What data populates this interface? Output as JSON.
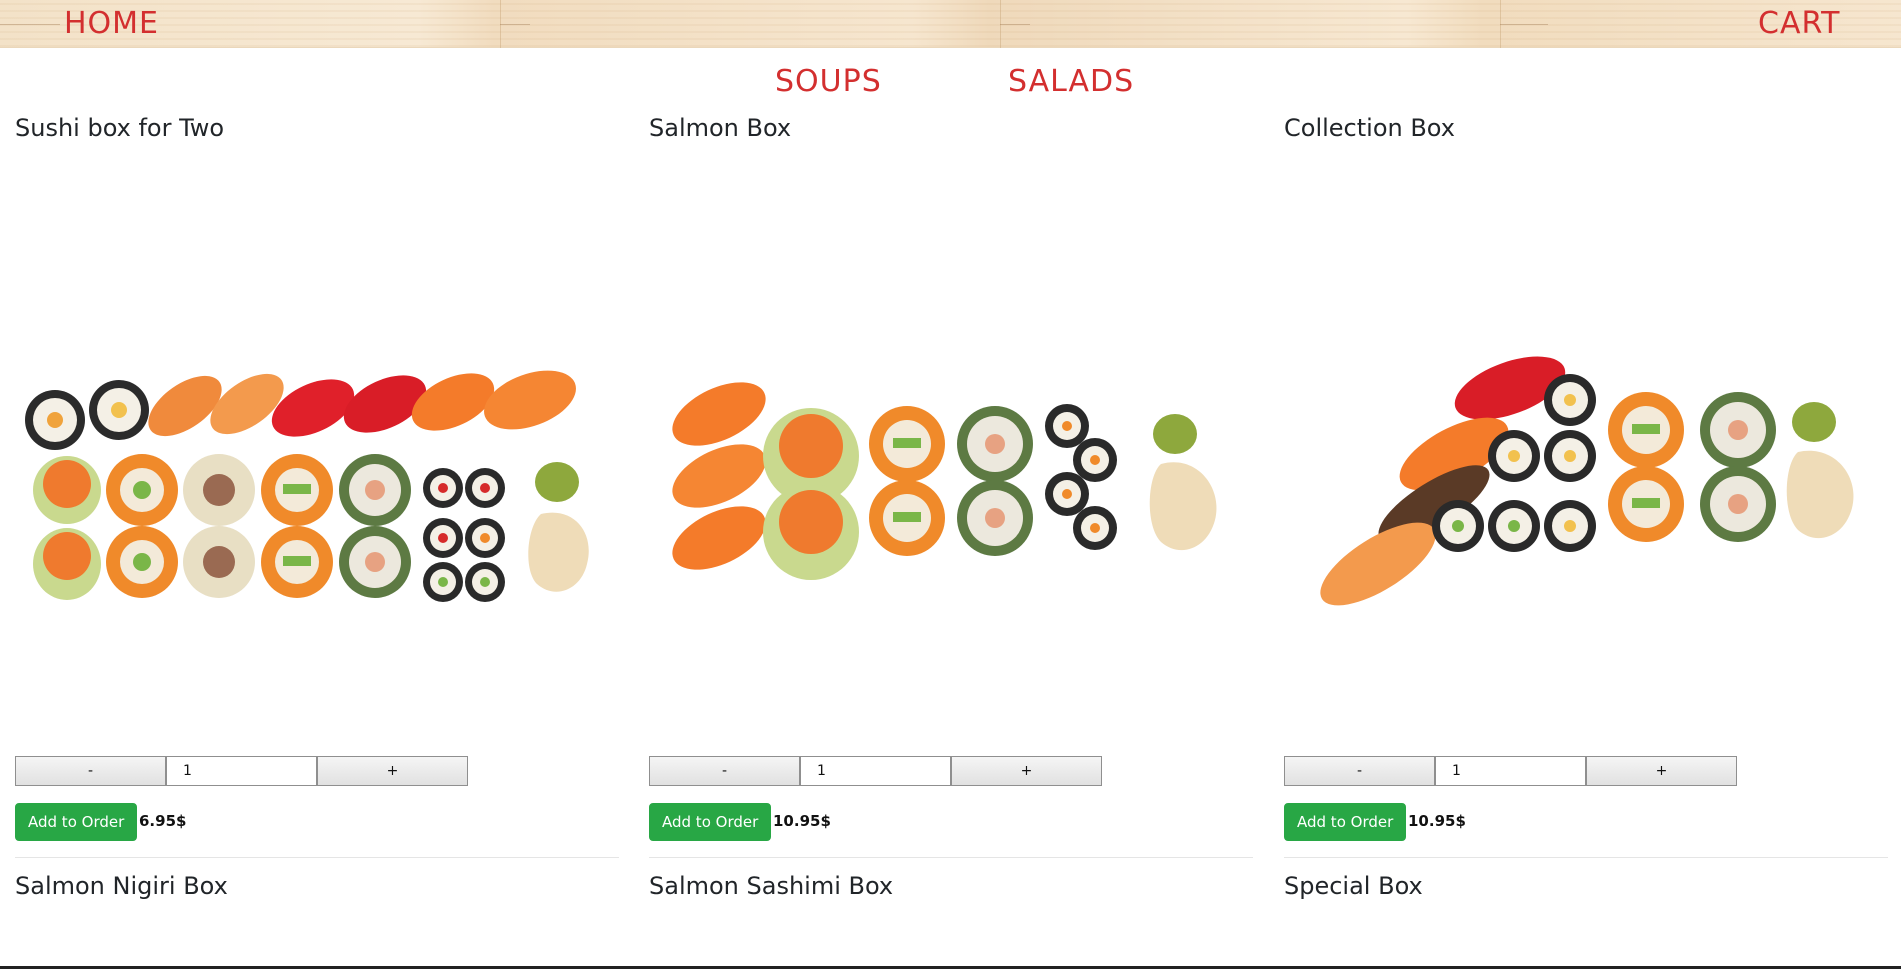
{
  "nav": {
    "home": "HOME",
    "cart": "CART",
    "soups": "SOUPS",
    "salads": "SALADS"
  },
  "products": [
    {
      "title": "Sushi box for Two",
      "qty": "1",
      "minus": "-",
      "plus": "+",
      "add_label": "Add to Order",
      "price": "6.95$",
      "next_title": "Salmon Nigiri Box"
    },
    {
      "title": "Salmon Box",
      "qty": "1",
      "minus": "-",
      "plus": "+",
      "add_label": "Add to Order",
      "price": "10.95$",
      "next_title": "Salmon Sashimi Box"
    },
    {
      "title": "Collection Box",
      "qty": "1",
      "minus": "-",
      "plus": "+",
      "add_label": "Add to Order",
      "price": "10.95$",
      "next_title": "Special Box"
    }
  ],
  "colors": {
    "nav_red": "#d32f2f",
    "add_green": "#28a745"
  }
}
